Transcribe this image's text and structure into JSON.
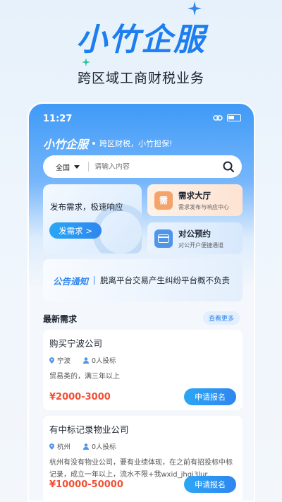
{
  "hero": {
    "title": "小竹企服",
    "subtitle": "跨区域工商财税业务"
  },
  "status_bar": {
    "time": "11:27"
  },
  "app": {
    "brand": "小竹企服",
    "slogan": "跨区财税，小竹担保!"
  },
  "search": {
    "region": "全国",
    "placeholder": "请输入内容"
  },
  "publish_card": {
    "text": "发布需求，极速响应",
    "button": "发需求 >"
  },
  "hall_card": {
    "title": "需求大厅",
    "subtitle": "需求发布与响应中心",
    "icon_text": "需"
  },
  "corp_card": {
    "title": "对公预约",
    "subtitle": "对公开户便捷通道"
  },
  "notice": {
    "tag": "公告通知",
    "message": "脱离平台交易产生纠纷平台概不负责"
  },
  "latest": {
    "heading": "最新需求",
    "more": "查看更多",
    "items": [
      {
        "title": "购买宁波公司",
        "location": "宁波",
        "bids": "0人投标",
        "desc": "贸易类的，满三年以上",
        "price": "¥2000-3000",
        "button": "申请报名"
      },
      {
        "title": "有中标记录物业公司",
        "location": "杭州",
        "bids": "0人投标",
        "desc": "杭州有没有物业公司，要有业绩体现，在之前有招投标中标记录，成立一年以上，流水不限+我wxid_jhqi3lur...",
        "price": "¥10000-50000",
        "button": "申请报名"
      }
    ]
  },
  "colors": {
    "brand_blue": "#1d7ef0",
    "price_red": "#f24f35"
  }
}
